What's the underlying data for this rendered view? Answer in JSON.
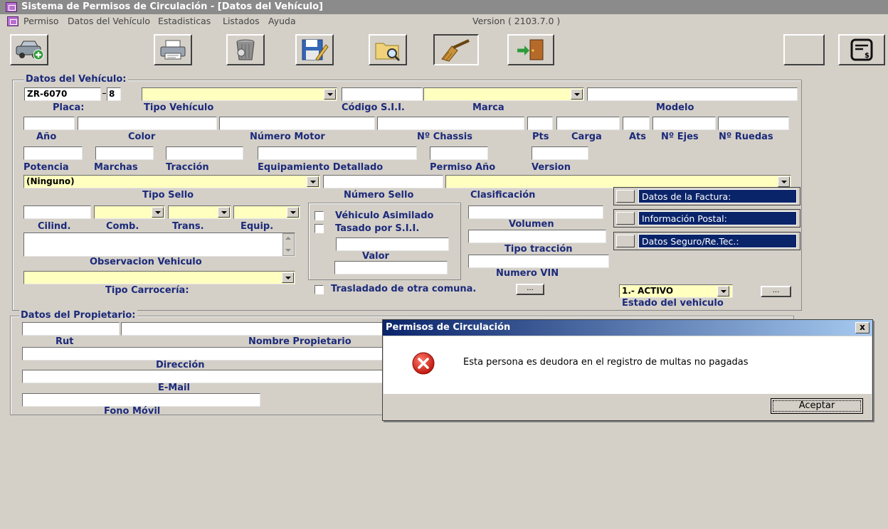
{
  "window": {
    "title": "Sistema de Permisos de Circulación - [Datos del Vehículo]"
  },
  "menu": {
    "items": [
      "Permiso",
      "Datos del Vehículo",
      "Estadisticas",
      "Listados",
      "Ayuda"
    ],
    "version": "Version ( 2103.7.0 )"
  },
  "toolbar": {
    "icons": [
      "car-add-icon",
      "printer-icon",
      "trash-icon",
      "save-edit-icon",
      "folder-search-icon",
      "broom-icon",
      "exit-door-icon",
      "blank-button",
      "invoice-icon"
    ]
  },
  "vehiculo": {
    "group_title": "Datos del Vehículo:",
    "placa": "ZR-6070",
    "placa_dv": "8",
    "tipo_vehiculo": "",
    "codigo_sii": "",
    "marca": "",
    "modelo": "",
    "labels": {
      "placa": "Placa:",
      "tipo_vehiculo": "Tipo Vehículo",
      "codigo_sii": "Código S.I.I.",
      "marca": "Marca",
      "modelo": "Modelo",
      "anio": "Año",
      "color": "Color",
      "numero_motor": "Número Motor",
      "chassis": "Nº Chassis",
      "pts": "Pts",
      "carga": "Carga",
      "ats": "Ats",
      "ejes": "Nº Ejes",
      "ruedas": "Nº Ruedas",
      "potencia": "Potencia",
      "marchas": "Marchas",
      "traccion": "Tracción",
      "equipamiento": "Equipamiento Detallado",
      "permiso_anio": "Permiso Año",
      "version": "Version",
      "tipo_sello": "Tipo Sello",
      "numero_sello": "Número Sello",
      "clasificacion": "Clasificación",
      "cilind": "Cilind.",
      "comb": "Comb.",
      "trans": "Trans.",
      "equip": "Equip.",
      "observacion": "Observacion Vehiculo",
      "tipo_carroceria": "Tipo Carrocería:",
      "vehiculo_asimilado": "Véhiculo Asimilado",
      "tasado_sii": "Tasado por S.I.I.",
      "valor": "Valor",
      "volumen": "Volumen",
      "tipo_traccion": "Tipo tracción",
      "numero_vin": "Numero VIN",
      "trasladado": "Trasladado de otra comuna.",
      "estado": "Estado del vehiculo"
    },
    "tipo_sello": "(Ninguno)",
    "estado": "1.- ACTIVO",
    "ellipsis": "...",
    "side_buttons": [
      "Datos de la Factura:",
      "Información Postal:",
      "Datos Seguro/Re.Tec.:"
    ]
  },
  "propietario": {
    "group_title": "Datos del Propietario:",
    "labels": {
      "rut": "Rut",
      "nombre": "Nombre Propietario",
      "direccion": "Dirección",
      "email": "E-Mail",
      "fono": "Fono Móvil"
    }
  },
  "dialog": {
    "title": "Permisos de Circulación",
    "close": "x",
    "message": "Esta persona es deudora en el registro de multas no pagadas",
    "ok_label": "Aceptar",
    "icon": "error-icon"
  }
}
